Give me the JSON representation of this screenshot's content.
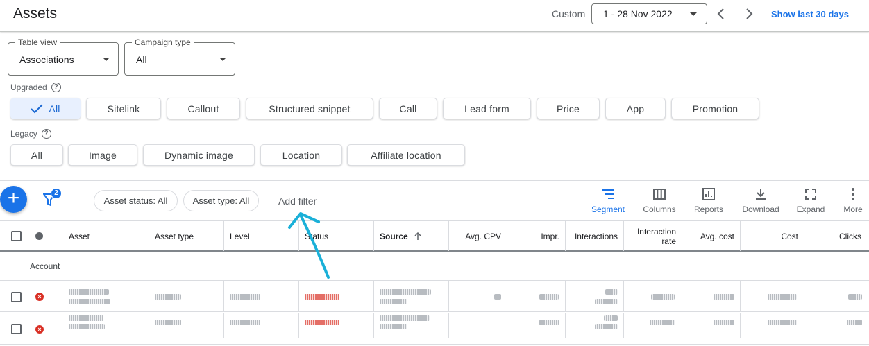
{
  "header": {
    "title": "Assets",
    "custom_label": "Custom",
    "date_range": "1 - 28 Nov 2022",
    "show_last": "Show last 30 days"
  },
  "filters": {
    "table_view": {
      "label": "Table view",
      "value": "Associations"
    },
    "campaign_type": {
      "label": "Campaign type",
      "value": "All"
    }
  },
  "upgraded": {
    "label": "Upgraded",
    "chips": [
      "All",
      "Sitelink",
      "Callout",
      "Structured snippet",
      "Call",
      "Lead form",
      "Price",
      "App",
      "Promotion"
    ],
    "selected": "All"
  },
  "legacy": {
    "label": "Legacy",
    "chips": [
      "All",
      "Image",
      "Dynamic image",
      "Location",
      "Affiliate location"
    ]
  },
  "toolbar": {
    "filter_count": "2",
    "pills": [
      "Asset status: All",
      "Asset type: All"
    ],
    "add_filter": "Add filter",
    "tools": [
      {
        "label": "Segment",
        "icon": "segment-icon"
      },
      {
        "label": "Columns",
        "icon": "columns-icon"
      },
      {
        "label": "Reports",
        "icon": "reports-icon"
      },
      {
        "label": "Download",
        "icon": "download-icon"
      },
      {
        "label": "Expand",
        "icon": "expand-icon"
      },
      {
        "label": "More",
        "icon": "more-vert-icon"
      }
    ]
  },
  "table": {
    "columns": [
      "Asset",
      "Asset type",
      "Level",
      "Status",
      "Source",
      "Avg. CPV",
      "Impr.",
      "Interactions",
      "Interaction rate",
      "Avg. cost",
      "Cost",
      "Clicks"
    ],
    "interaction_rate_lines": [
      "Interaction",
      "rate"
    ],
    "account_row": "Account"
  },
  "colors": {
    "accent": "#1a73e8",
    "selected_chip_bg": "#e8f0fe",
    "removed_status": "#d93025"
  }
}
